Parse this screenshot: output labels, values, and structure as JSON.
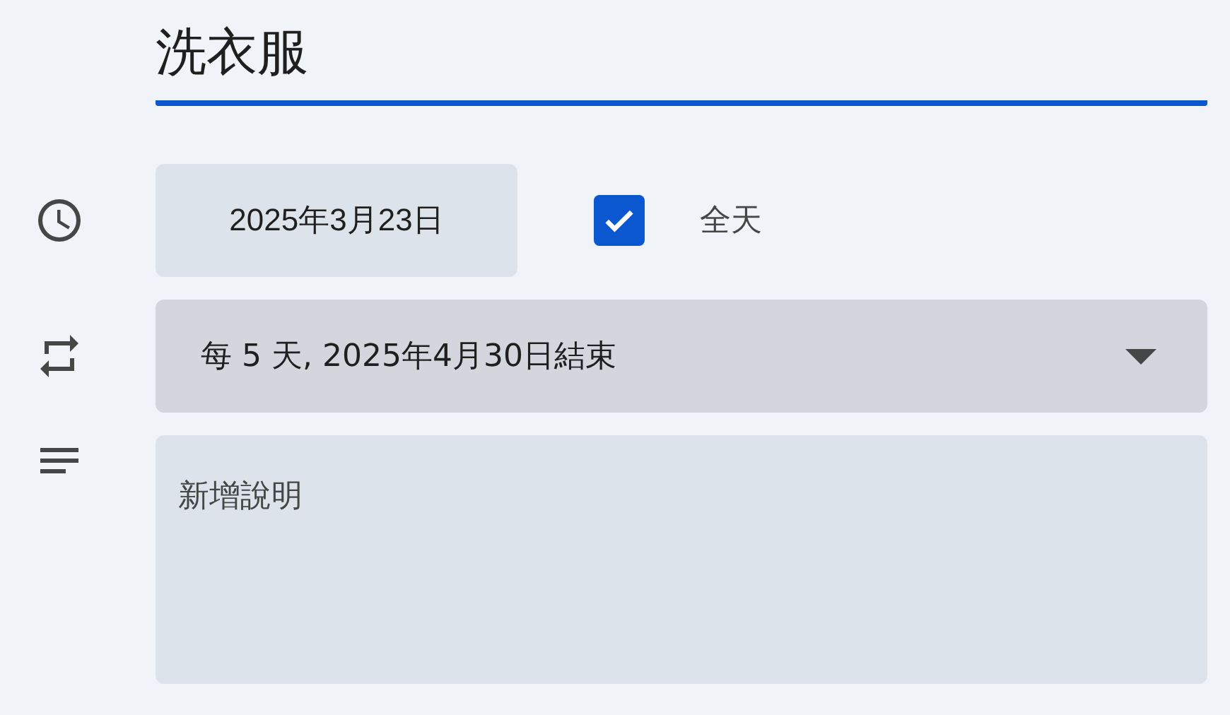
{
  "title": {
    "value": "洗衣服"
  },
  "date": {
    "value": "2025年3月23日"
  },
  "all_day": {
    "label": "全天",
    "checked": true
  },
  "recurrence": {
    "value": "每 5 天, 2025年4月30日結束"
  },
  "description": {
    "placeholder": "新增說明"
  }
}
